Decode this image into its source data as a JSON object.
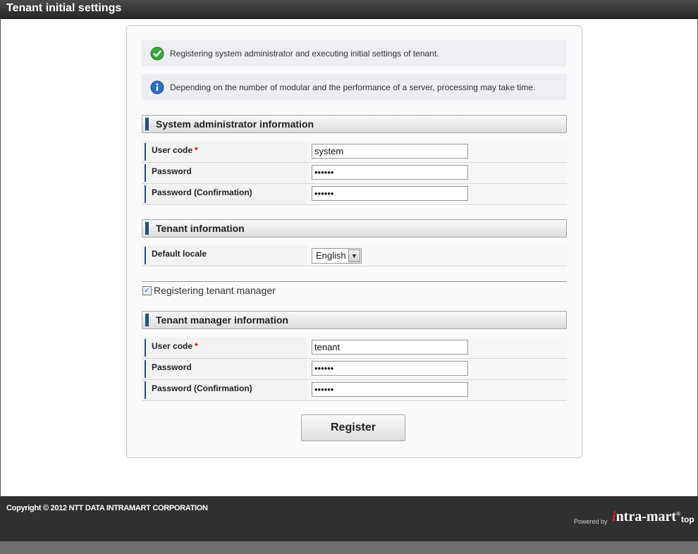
{
  "window": {
    "title": "Tenant initial settings"
  },
  "messages": {
    "success": "Registering system administrator and executing initial settings of tenant.",
    "info": "Depending on the number of modular and the performance of a server, processing may take time."
  },
  "system_admin": {
    "heading": "System administrator information",
    "user_code_label": "User code",
    "user_code_value": "system",
    "password_label": "Password",
    "password_value": "••••••",
    "password_confirm_label": "Password (Confirmation)",
    "password_confirm_value": "••••••"
  },
  "tenant": {
    "heading": "Tenant information",
    "locale_label": "Default locale",
    "locale_value": "English"
  },
  "register_manager": {
    "label": "Registering tenant manager",
    "checked": true
  },
  "tenant_manager": {
    "heading": "Tenant manager information",
    "user_code_label": "User code",
    "user_code_value": "tenant",
    "password_label": "Password",
    "password_value": "••••••",
    "password_confirm_label": "Password (Confirmation)",
    "password_confirm_value": "••••••"
  },
  "required_mark": "*",
  "register_button": "Register",
  "footer": {
    "copyright": "Copyright © 2012 NTT DATA INTRAMART CORPORATION",
    "powered_by": "Powered by",
    "logo_i": "i",
    "logo_rest": "ntra-mart",
    "logo_reg": "®",
    "top_link": "top"
  },
  "colors": {
    "accent_bar": "#2c4a8a",
    "required": "#dd0000",
    "success_icon": "#3aa53a",
    "info_icon": "#2f6fc7"
  }
}
